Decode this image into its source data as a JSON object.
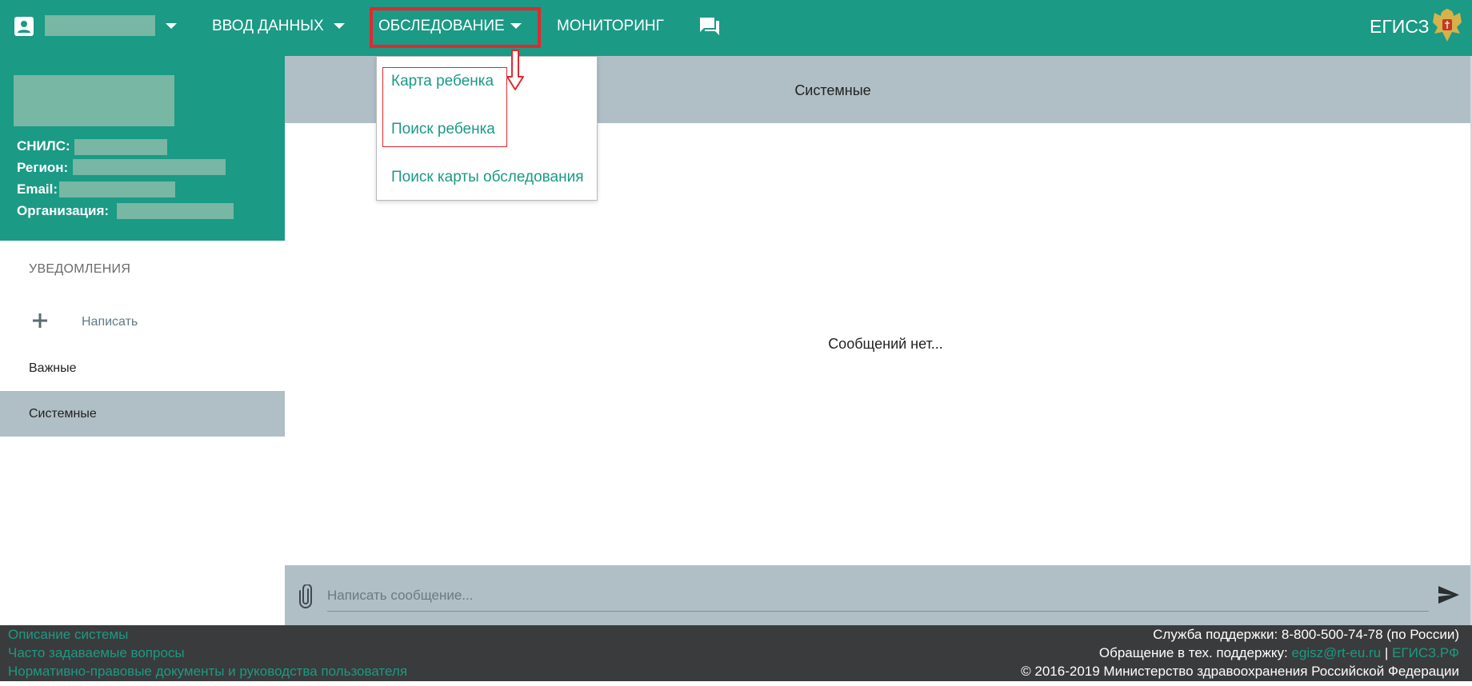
{
  "colors": {
    "primary": "#1b9a85",
    "header_gray": "#b0bfc6",
    "footer_bg": "#3a3b3c",
    "annotation_red": "#e2282e",
    "mask": "#77b7a4"
  },
  "topbar": {
    "user_icon": "account-box-icon",
    "nav": [
      {
        "label": "ВВОД ДАННЫХ",
        "has_dropdown": true
      },
      {
        "label": "ОБСЛЕДОВАНИЕ",
        "has_dropdown": true,
        "highlighted": true
      },
      {
        "label": "МОНИТОРИНГ",
        "has_dropdown": false
      }
    ],
    "chat_icon": "chat-icon",
    "brand": "ЕГИСЗ",
    "emblem_icon": "emblem-icon"
  },
  "profile": {
    "snils_label": "СНИЛС:",
    "region_label": "Регион:",
    "email_label": "Email:",
    "org_label": "Организация:"
  },
  "sidebar": {
    "heading": "УВЕДОМЛЕНИЯ",
    "write_label": "Написать",
    "items": [
      {
        "label": "Важные",
        "active": false
      },
      {
        "label": "Системные",
        "active": true
      }
    ]
  },
  "dropdown": {
    "items": [
      {
        "label": "Карта ребенка"
      },
      {
        "label": "Поиск ребенка"
      },
      {
        "label": "Поиск карты обследования"
      }
    ]
  },
  "main": {
    "header_title": "Системные",
    "empty_message": "Сообщений нет...",
    "composer": {
      "placeholder": "Написать сообщение...",
      "attach_icon": "paperclip-icon",
      "send_icon": "send-icon"
    }
  },
  "footer": {
    "links": [
      "Описание системы",
      "Часто задаваемые вопросы",
      "Нормативно-правовые документы и руководства пользователя"
    ],
    "support_line": "Служба поддержки: 8-800-500-74-78 (по России)",
    "tech_prefix": "Обращение в тех. поддержку:",
    "tech_email": "egisz@rt-eu.ru",
    "tech_sep": "|",
    "tech_site": "ЕГИСЗ.РФ",
    "copyright": "© 2016-2019 Министерство здравоохранения Российской Федерации"
  }
}
